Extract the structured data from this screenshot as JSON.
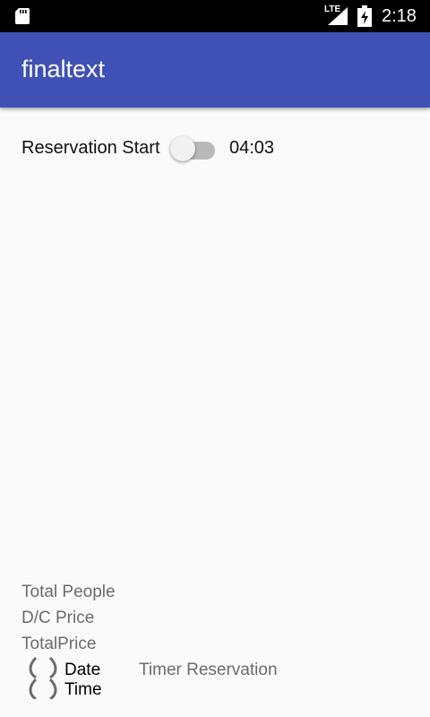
{
  "status_bar": {
    "time": "2:18",
    "network": "LTE",
    "icons": [
      "sd-card-icon",
      "signal-icon",
      "battery-charging-icon"
    ]
  },
  "app_bar": {
    "title": "finaltext",
    "color": "#3f51b5"
  },
  "reservation": {
    "label": "Reservation Start",
    "switch_on": false,
    "time": "04:03"
  },
  "summary": {
    "total_people": "Total People",
    "dc_price": "D/C Price",
    "total_price": "TotalPrice"
  },
  "footer": {
    "date": "Date",
    "time": "Time",
    "timer_reservation": "Timer Reservation"
  }
}
